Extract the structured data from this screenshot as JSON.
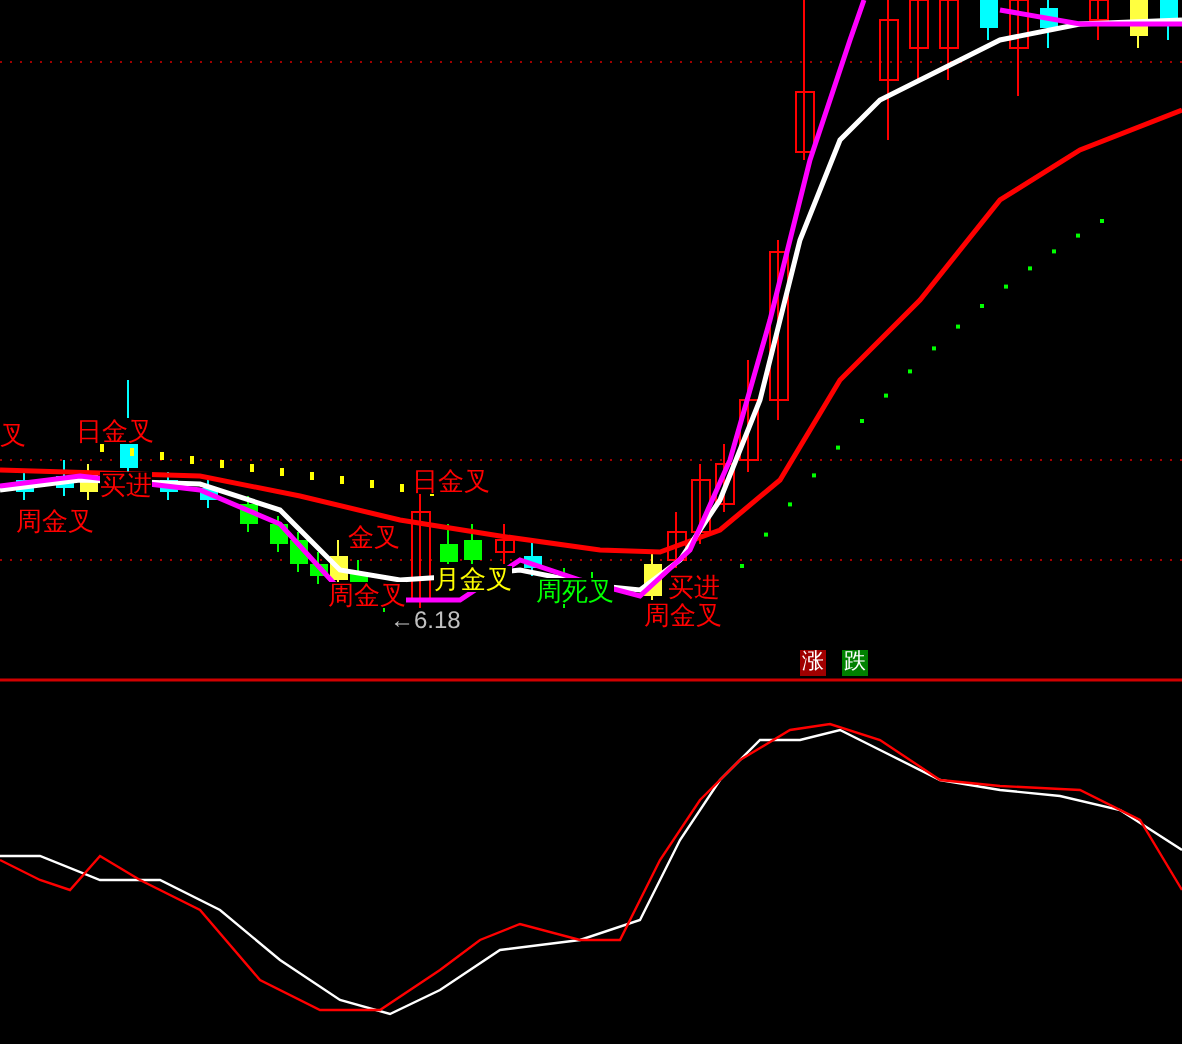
{
  "signals": [
    {
      "text": "叉",
      "color": "#ff0000"
    },
    {
      "text": "日金叉",
      "color": "#ff0000"
    },
    {
      "text": "买进",
      "color": "#ff0000"
    },
    {
      "text": "周金叉",
      "color": "#ff0000"
    },
    {
      "text": "日金叉",
      "color": "#ff0000"
    },
    {
      "text": "金叉",
      "color": "#ff0000"
    },
    {
      "text": "周金叉",
      "color": "#ff0000"
    },
    {
      "text": "月金叉",
      "color": "#ffff00"
    },
    {
      "text": "周死叉",
      "color": "#00ff00"
    },
    {
      "text": "买进",
      "color": "#ff0000"
    },
    {
      "text": "周金叉",
      "color": "#ff0000"
    }
  ],
  "low_marker": "←6.18",
  "legend": [
    {
      "text": "涨",
      "color": "#a00000"
    },
    {
      "text": "跌",
      "color": "#008000"
    }
  ]
}
